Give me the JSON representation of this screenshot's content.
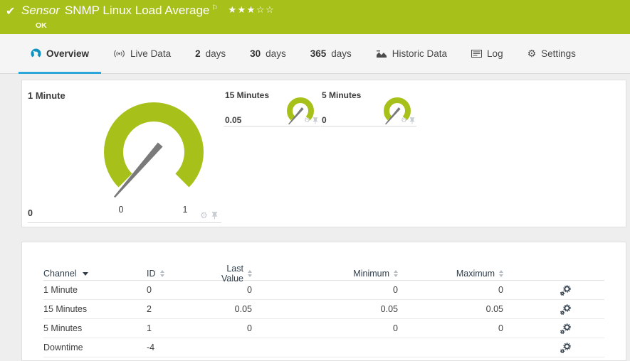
{
  "header": {
    "kind": "Sensor",
    "title": "SNMP Linux Load Average",
    "status": "OK",
    "stars_filled": "★★★",
    "stars_empty": "☆☆"
  },
  "tabs": {
    "overview": "Overview",
    "live_data": "Live Data",
    "d2_num": "2",
    "d2_unit": "days",
    "d30_num": "30",
    "d30_unit": "days",
    "d365_num": "365",
    "d365_unit": "days",
    "historic_data": "Historic Data",
    "log": "Log",
    "settings": "Settings"
  },
  "gauges": {
    "minute1": {
      "name": "1 Minute",
      "value": "0",
      "scale_min": "0",
      "scale_max": "1"
    },
    "minutes15": {
      "name": "15 Minutes",
      "value": "0.05"
    },
    "minutes5": {
      "name": "5 Minutes",
      "value": "0"
    }
  },
  "channel_table": {
    "headers": {
      "channel": "Channel",
      "id": "ID",
      "last_value": "Last Value",
      "minimum": "Minimum",
      "maximum": "Maximum"
    },
    "rows": [
      {
        "channel": "1 Minute",
        "id": "0",
        "last_value": "0",
        "minimum": "0",
        "maximum": "0"
      },
      {
        "channel": "15 Minutes",
        "id": "2",
        "last_value": "0.05",
        "minimum": "0.05",
        "maximum": "0.05"
      },
      {
        "channel": "5 Minutes",
        "id": "1",
        "last_value": "0",
        "minimum": "0",
        "maximum": "0"
      },
      {
        "channel": "Downtime",
        "id": "-4",
        "last_value": "",
        "minimum": "",
        "maximum": ""
      }
    ]
  },
  "colors": {
    "status_green": "#a8c11a",
    "active_tab_blue": "#2ba6da",
    "gauge_green": "#a8c11a",
    "needle_gray": "#7a7a7a"
  }
}
